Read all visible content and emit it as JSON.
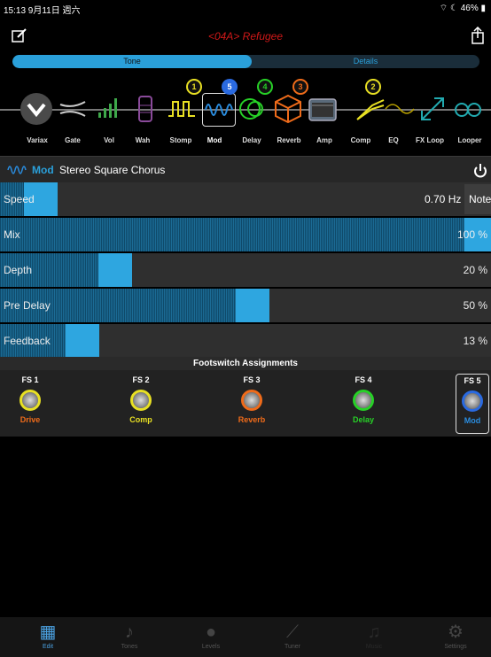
{
  "status": {
    "left": "15:13  9月11日 週六",
    "right": "⌔ ☾ 46% ▮"
  },
  "header": {
    "title": "<04A> Refugee"
  },
  "tabs": {
    "tone": "Tone",
    "details": "Details"
  },
  "blocks": [
    {
      "label": "Varix",
      "full": "Varix"
    },
    {
      "label": "Gate"
    },
    {
      "label": "Vol"
    },
    {
      "label": "Wah"
    },
    {
      "label": "Stomp",
      "badge": "1",
      "color": "#e8e023"
    },
    {
      "label": "Mod",
      "badge": "5",
      "color": "#2a6ae0"
    },
    {
      "label": "Delay",
      "badge": "4",
      "color": "#27d127"
    },
    {
      "label": "Reverb",
      "badge": "3",
      "color": "#ef6b1a"
    },
    {
      "label": "Amp"
    },
    {
      "label": "Comp",
      "badge": "2",
      "color": "#e8e023"
    },
    {
      "label": "EQ"
    },
    {
      "label": "FX Loop"
    },
    {
      "label": "Looper"
    }
  ],
  "block_labels": [
    "Variax",
    "Gate",
    "Vol",
    "Wah",
    "Stomp",
    "Mod",
    "Delay",
    "Reverb",
    "Amp",
    "Comp",
    "EQ",
    "FX Loop",
    "Looper"
  ],
  "module": {
    "type": "Mod",
    "name": "Stereo Square Chorus"
  },
  "params": [
    {
      "name": "Speed",
      "value": "0.70 Hz",
      "extra": "Note",
      "level": 0.07
    },
    {
      "name": "Mix",
      "value": "100 %",
      "level": 1.0
    },
    {
      "name": "Depth",
      "value": "20 %",
      "level": 0.2
    },
    {
      "name": "Pre Delay",
      "value": "50 %",
      "level": 0.5
    },
    {
      "name": "Feedback",
      "value": "13 %",
      "level": 0.13
    }
  ],
  "footswitch": {
    "title": "Footswitch Assignments",
    "items": [
      {
        "id": "FS 1",
        "assign": "Drive",
        "color": "#e8e023"
      },
      {
        "id": "FS 2",
        "assign": "Comp",
        "color": "#e8e023"
      },
      {
        "id": "FS 3",
        "assign": "Reverb",
        "color": "#ef6b1a"
      },
      {
        "id": "FS 4",
        "assign": "Delay",
        "color": "#27d127"
      },
      {
        "id": "FS 5",
        "assign": "Mod",
        "color": "#2a6ae0"
      }
    ]
  },
  "nav": [
    "Edit",
    "Tones",
    "Levels",
    "Tuner",
    "Music",
    "Settings"
  ]
}
